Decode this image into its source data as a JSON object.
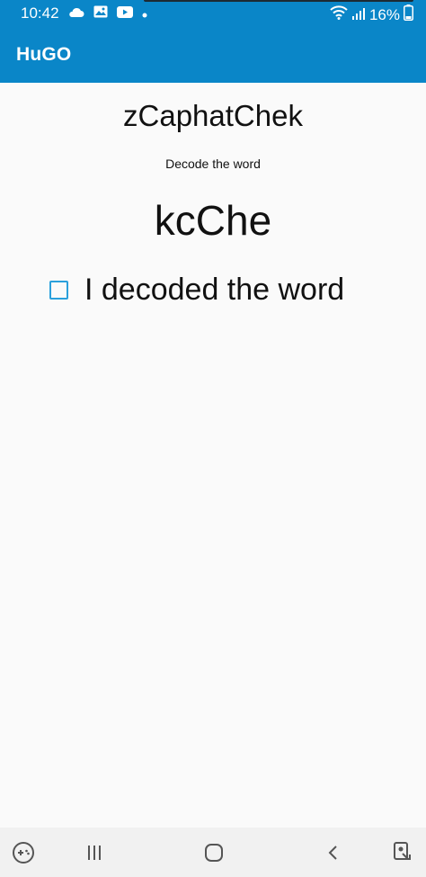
{
  "status_bar": {
    "time": "10:42",
    "battery": "16%",
    "icons": [
      "cloud-icon",
      "image-icon",
      "youtube-icon",
      "dot-icon",
      "wifi-icon",
      "signal-icon",
      "battery-icon"
    ]
  },
  "app_bar": {
    "title": "HuGO",
    "color": "#0a86c8"
  },
  "main": {
    "heading": "zCaphatChek",
    "subtitle": "Decode the word",
    "puzzle_word": "kcChe",
    "checkbox": {
      "label": "I decoded the word",
      "checked": false,
      "color": "#2aa0dc"
    }
  },
  "nav_bar": {
    "buttons": [
      "game-icon",
      "recent-apps-icon",
      "home-icon",
      "back-icon",
      "assistant-icon"
    ]
  }
}
